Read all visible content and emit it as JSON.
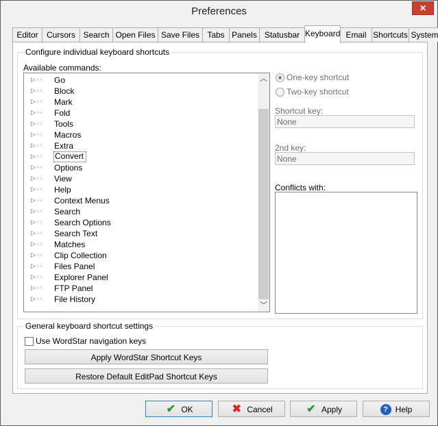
{
  "window": {
    "title": "Preferences",
    "close_glyph": "✕"
  },
  "tabs": [
    "Editor",
    "Cursors",
    "Search",
    "Open Files",
    "Save Files",
    "Tabs",
    "Panels",
    "Statusbar",
    "Keyboard",
    "Email",
    "Shortcuts",
    "System"
  ],
  "active_tab": "Keyboard",
  "keyboard": {
    "group_title": "Configure individual keyboard shortcuts",
    "available_label": "Available commands:",
    "commands": [
      "Go",
      "Block",
      "Mark",
      "Fold",
      "Tools",
      "Macros",
      "Extra",
      "Convert",
      "Options",
      "View",
      "Help",
      "Context Menus",
      "Search",
      "Search Options",
      "Search Text",
      "Matches",
      "Clip Collection",
      "Files Panel",
      "Explorer Panel",
      "FTP Panel",
      "File History"
    ],
    "focused_command": "Convert",
    "one_key": "One-key shortcut",
    "two_key": "Two-key shortcut",
    "shortcut_key_label": "Shortcut key:",
    "shortcut_key_value": "None",
    "second_key_label": "2nd key:",
    "second_key_value": "None",
    "conflicts_label": "Conflicts with:"
  },
  "general": {
    "group_title": "General keyboard shortcut settings",
    "wordstar_checkbox": "Use WordStar navigation keys",
    "apply_wordstar": "Apply WordStar Shortcut Keys",
    "restore_default": "Restore Default EditPad Shortcut Keys"
  },
  "buttons": {
    "ok": "OK",
    "cancel": "Cancel",
    "apply": "Apply",
    "help": "Help"
  },
  "colors": {
    "ok_icon": "#2e9a2e",
    "cancel_icon": "#d62b2b",
    "apply_icon": "#2e9a2e",
    "help_icon": "#1f5fbf"
  },
  "icons": {
    "ok": "check-icon",
    "cancel": "cross-icon",
    "apply": "check-icon",
    "help": "help-icon"
  }
}
